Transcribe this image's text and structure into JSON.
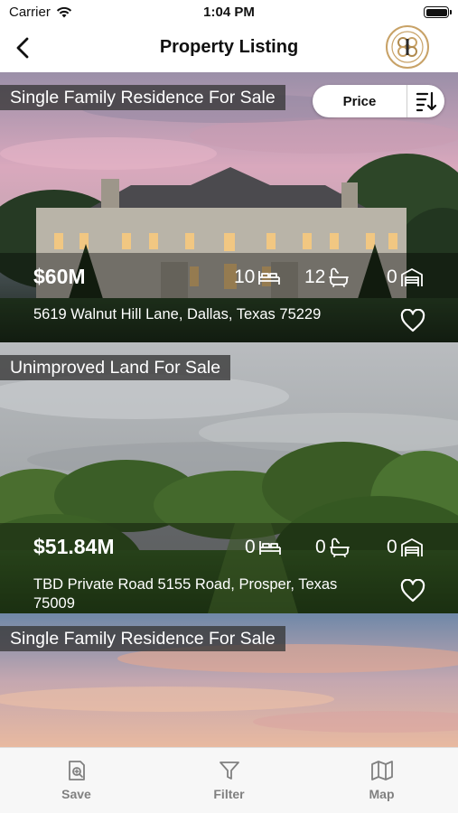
{
  "status_bar": {
    "carrier": "Carrier",
    "time": "1:04 PM"
  },
  "nav": {
    "title": "Property Listing",
    "back_icon": "chevron-left-icon",
    "logo_icon": "brand-logo"
  },
  "sort": {
    "label": "Price",
    "icon": "sort-descending-icon"
  },
  "listings": [
    {
      "type": "Single Family Residence For Sale",
      "price": "$60M",
      "beds": "10",
      "baths": "12",
      "garage": "0",
      "address": "5619 Walnut Hill Lane, Dallas, Texas 75229"
    },
    {
      "type": "Unimproved Land For Sale",
      "price": "$51.84M",
      "beds": "0",
      "baths": "0",
      "garage": "0",
      "address": "TBD Private Road 5155 Road, Prosper, Texas 75009"
    },
    {
      "type": "Single Family Residence For Sale"
    }
  ],
  "tab_bar": {
    "items": [
      {
        "label": "Save",
        "icon": "save-search-icon"
      },
      {
        "label": "Filter",
        "icon": "filter-icon"
      },
      {
        "label": "Map",
        "icon": "map-icon"
      }
    ]
  },
  "colors": {
    "accent_gold": "#c8a267",
    "tab_gray": "#808080"
  }
}
